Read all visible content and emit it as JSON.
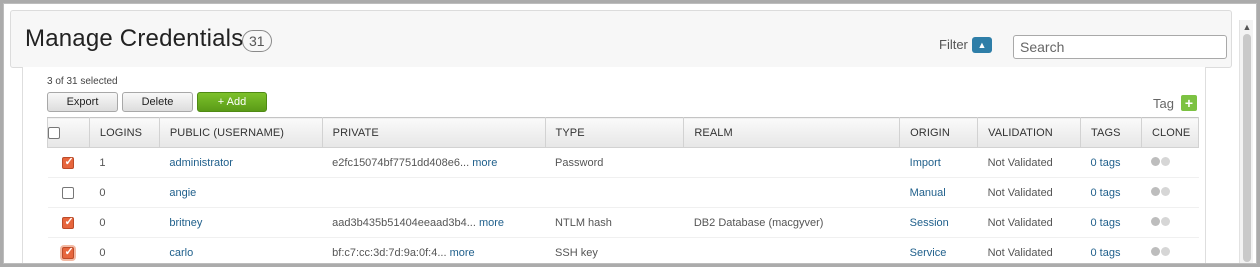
{
  "header": {
    "title": "Manage Credentials",
    "count": "31",
    "filter_label": "Filter",
    "search_placeholder": "Search"
  },
  "toolbar": {
    "selected_text": "3 of 31 selected",
    "export_label": "Export",
    "delete_label": "Delete",
    "add_label": "+ Add",
    "tag_label": "Tag",
    "tag_add_label": "+"
  },
  "table": {
    "columns": [
      "LOGINS",
      "PUBLIC (USERNAME)",
      "PRIVATE",
      "TYPE",
      "REALM",
      "ORIGIN",
      "VALIDATION",
      "TAGS",
      "CLONE"
    ],
    "rows": [
      {
        "checked": true,
        "logins": "1",
        "username": "administrator",
        "private": "e2fc15074bf7751dd408e6...",
        "more": "more",
        "type": "Password",
        "realm": "",
        "origin": "Import",
        "validation": "Not Validated",
        "tags": "0 tags"
      },
      {
        "checked": false,
        "logins": "0",
        "username": "angie",
        "private": "",
        "more": "",
        "type": "",
        "realm": "",
        "origin": "Manual",
        "validation": "Not Validated",
        "tags": "0 tags"
      },
      {
        "checked": true,
        "logins": "0",
        "username": "britney",
        "private": "aad3b435b51404eeaad3b4...",
        "more": "more",
        "type": "NTLM hash",
        "realm": "DB2 Database (macgyver)",
        "origin": "Session",
        "validation": "Not Validated",
        "tags": "0 tags"
      },
      {
        "checked": true,
        "logins": "0",
        "username": "carlo",
        "private": "bf:c7:cc:3d:7d:9a:0f:4...",
        "more": "more",
        "type": "SSH key",
        "realm": "",
        "origin": "Service",
        "validation": "Not Validated",
        "tags": "0 tags"
      }
    ]
  },
  "colors": {
    "accent_blue": "#2e7ea8",
    "add_green": "#5a9b17",
    "checkbox_orange": "#e7663d",
    "link_blue": "#1f5f8b"
  },
  "icons": {
    "filter": "chevron-up-icon",
    "clone": "clone-dots-icon",
    "scroll_up": "scroll-up-arrow-icon"
  }
}
